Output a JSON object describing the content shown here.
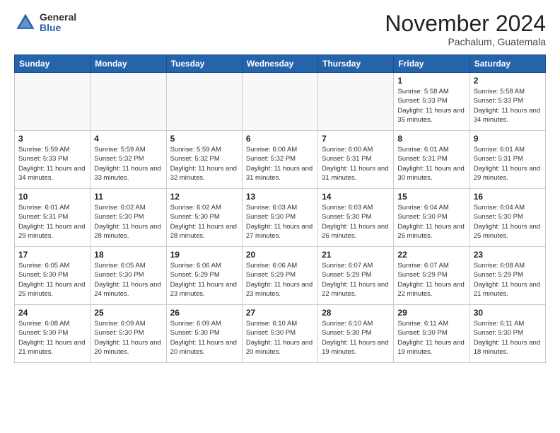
{
  "header": {
    "logo_general": "General",
    "logo_blue": "Blue",
    "month_title": "November 2024",
    "location": "Pachalum, Guatemala"
  },
  "weekdays": [
    "Sunday",
    "Monday",
    "Tuesday",
    "Wednesday",
    "Thursday",
    "Friday",
    "Saturday"
  ],
  "weeks": [
    [
      {
        "day": "",
        "info": ""
      },
      {
        "day": "",
        "info": ""
      },
      {
        "day": "",
        "info": ""
      },
      {
        "day": "",
        "info": ""
      },
      {
        "day": "",
        "info": ""
      },
      {
        "day": "1",
        "info": "Sunrise: 5:58 AM\nSunset: 5:33 PM\nDaylight: 11 hours\nand 35 minutes."
      },
      {
        "day": "2",
        "info": "Sunrise: 5:58 AM\nSunset: 5:33 PM\nDaylight: 11 hours\nand 34 minutes."
      }
    ],
    [
      {
        "day": "3",
        "info": "Sunrise: 5:59 AM\nSunset: 5:33 PM\nDaylight: 11 hours\nand 34 minutes."
      },
      {
        "day": "4",
        "info": "Sunrise: 5:59 AM\nSunset: 5:32 PM\nDaylight: 11 hours\nand 33 minutes."
      },
      {
        "day": "5",
        "info": "Sunrise: 5:59 AM\nSunset: 5:32 PM\nDaylight: 11 hours\nand 32 minutes."
      },
      {
        "day": "6",
        "info": "Sunrise: 6:00 AM\nSunset: 5:32 PM\nDaylight: 11 hours\nand 31 minutes."
      },
      {
        "day": "7",
        "info": "Sunrise: 6:00 AM\nSunset: 5:31 PM\nDaylight: 11 hours\nand 31 minutes."
      },
      {
        "day": "8",
        "info": "Sunrise: 6:01 AM\nSunset: 5:31 PM\nDaylight: 11 hours\nand 30 minutes."
      },
      {
        "day": "9",
        "info": "Sunrise: 6:01 AM\nSunset: 5:31 PM\nDaylight: 11 hours\nand 29 minutes."
      }
    ],
    [
      {
        "day": "10",
        "info": "Sunrise: 6:01 AM\nSunset: 5:31 PM\nDaylight: 11 hours\nand 29 minutes."
      },
      {
        "day": "11",
        "info": "Sunrise: 6:02 AM\nSunset: 5:30 PM\nDaylight: 11 hours\nand 28 minutes."
      },
      {
        "day": "12",
        "info": "Sunrise: 6:02 AM\nSunset: 5:30 PM\nDaylight: 11 hours\nand 28 minutes."
      },
      {
        "day": "13",
        "info": "Sunrise: 6:03 AM\nSunset: 5:30 PM\nDaylight: 11 hours\nand 27 minutes."
      },
      {
        "day": "14",
        "info": "Sunrise: 6:03 AM\nSunset: 5:30 PM\nDaylight: 11 hours\nand 26 minutes."
      },
      {
        "day": "15",
        "info": "Sunrise: 6:04 AM\nSunset: 5:30 PM\nDaylight: 11 hours\nand 26 minutes."
      },
      {
        "day": "16",
        "info": "Sunrise: 6:04 AM\nSunset: 5:30 PM\nDaylight: 11 hours\nand 25 minutes."
      }
    ],
    [
      {
        "day": "17",
        "info": "Sunrise: 6:05 AM\nSunset: 5:30 PM\nDaylight: 11 hours\nand 25 minutes."
      },
      {
        "day": "18",
        "info": "Sunrise: 6:05 AM\nSunset: 5:30 PM\nDaylight: 11 hours\nand 24 minutes."
      },
      {
        "day": "19",
        "info": "Sunrise: 6:06 AM\nSunset: 5:29 PM\nDaylight: 11 hours\nand 23 minutes."
      },
      {
        "day": "20",
        "info": "Sunrise: 6:06 AM\nSunset: 5:29 PM\nDaylight: 11 hours\nand 23 minutes."
      },
      {
        "day": "21",
        "info": "Sunrise: 6:07 AM\nSunset: 5:29 PM\nDaylight: 11 hours\nand 22 minutes."
      },
      {
        "day": "22",
        "info": "Sunrise: 6:07 AM\nSunset: 5:29 PM\nDaylight: 11 hours\nand 22 minutes."
      },
      {
        "day": "23",
        "info": "Sunrise: 6:08 AM\nSunset: 5:29 PM\nDaylight: 11 hours\nand 21 minutes."
      }
    ],
    [
      {
        "day": "24",
        "info": "Sunrise: 6:08 AM\nSunset: 5:30 PM\nDaylight: 11 hours\nand 21 minutes."
      },
      {
        "day": "25",
        "info": "Sunrise: 6:09 AM\nSunset: 5:30 PM\nDaylight: 11 hours\nand 20 minutes."
      },
      {
        "day": "26",
        "info": "Sunrise: 6:09 AM\nSunset: 5:30 PM\nDaylight: 11 hours\nand 20 minutes."
      },
      {
        "day": "27",
        "info": "Sunrise: 6:10 AM\nSunset: 5:30 PM\nDaylight: 11 hours\nand 20 minutes."
      },
      {
        "day": "28",
        "info": "Sunrise: 6:10 AM\nSunset: 5:30 PM\nDaylight: 11 hours\nand 19 minutes."
      },
      {
        "day": "29",
        "info": "Sunrise: 6:11 AM\nSunset: 5:30 PM\nDaylight: 11 hours\nand 19 minutes."
      },
      {
        "day": "30",
        "info": "Sunrise: 6:11 AM\nSunset: 5:30 PM\nDaylight: 11 hours\nand 18 minutes."
      }
    ]
  ]
}
